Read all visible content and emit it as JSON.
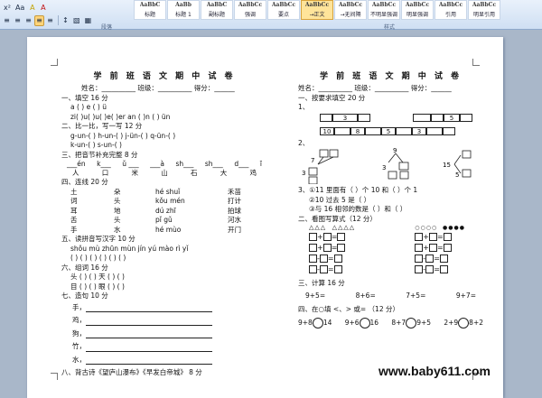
{
  "ribbon": {
    "format_buttons": [
      "x²",
      "Aa",
      "A",
      "A"
    ],
    "paragraph_buttons": [
      "≡",
      "≡",
      "≡",
      "≡",
      "≡"
    ],
    "style_tiles": [
      {
        "sample": "AaBbC",
        "label": "标题"
      },
      {
        "sample": "AaBb",
        "label": "标题 1"
      },
      {
        "sample": "AaBbC",
        "label": "副标题"
      },
      {
        "sample": "AaBbCc",
        "label": "强调"
      },
      {
        "sample": "AaBbCc",
        "label": "要点"
      },
      {
        "sample": "AaBbCc",
        "label": "→正文"
      },
      {
        "sample": "AaBbCc",
        "label": "→无间隔"
      },
      {
        "sample": "AaBbCc",
        "label": "不明显强调"
      },
      {
        "sample": "AaBbCc",
        "label": "明显强调"
      },
      {
        "sample": "AaBbCc",
        "label": "引用"
      },
      {
        "sample": "AaBbCc",
        "label": "明显引用"
      },
      {
        "sample": "AaBbCc",
        "label": "不明显参考"
      }
    ],
    "group_paragraph": "段落",
    "group_styles": "样式"
  },
  "left": {
    "title": "学 前 班 语 文 期 中 试 卷",
    "header_line": "姓名：__________   班级：__________   得分：______",
    "sec1": "一、填空   16 分",
    "sec1_a": "a  (    )  e  (    )  ü",
    "sec1_b": "zi(    )u(    )u(    )e(    )er an  (    )n (    ) ün",
    "sec2": "二、比一比，写一写   12 分",
    "sec2_a": "g-un-(    )     h-un-(    )     j-ün-(    )     q-ün-(    )",
    "sec2_b": "k-un-(    )     s-un-(    )",
    "sec3": "三、把音节补充完整   8 分",
    "pinyin_row": [
      "___én",
      "k___",
      "ǔ ___",
      "___à",
      "sh___",
      "sh___",
      "d___",
      "ī"
    ],
    "hanzi_row": [
      "人",
      "口",
      "米",
      "山",
      "石",
      "大",
      "鸡"
    ],
    "sec4": "四、连线   20 分",
    "match_left": [
      "土",
      "词",
      "耳",
      "舌",
      "手"
    ],
    "match_mid": [
      "朵",
      "头",
      "地",
      "头",
      "水"
    ],
    "match_py": [
      "hé  shuǐ",
      "kǒu  mén",
      "dú  zhī",
      "pǐ  gǔ",
      "hé  mùo"
    ],
    "match_right": [
      "禾苗",
      "打计",
      "拍球",
      "河水",
      "开门"
    ],
    "sec5": "五、读拼音写汉字   10 分",
    "sec5_py": "shǒu  mù    zhūn  mùn    jín    yú  mào    rì    yǐ",
    "sec5_blanks": "(    )  (    )   (    )  (    )   (    )   (    )",
    "sec6": "六、组词   16 分",
    "sec6_a": "头  (      )  (      )        天  (      )  (      )",
    "sec6_b": "目  (      )  (      )        眼  (      )  (      )",
    "sec7": "七、造句   10 分",
    "sentence_labels": [
      "手，",
      "鸡，",
      "狗，",
      "竹，",
      "水，"
    ],
    "sec8": "八、背古诗《望庐山瀑布》《早发白帝城》   8 分"
  },
  "right": {
    "title": "学 前 班 语 文 期 中 试 卷",
    "header_line": "姓名：__________  班级：__________  得分：______",
    "sec1": "一、按要求填空   20 分",
    "sec1_sub": "1、",
    "row_a_left": [
      "",
      "3",
      "",
      ""
    ],
    "row_a_right": [
      "",
      "",
      "5",
      ""
    ],
    "row_b": [
      "10",
      "",
      "8",
      "",
      "5",
      "",
      "3",
      "",
      ""
    ],
    "sec1_sub2": "2、",
    "tree_nums": [
      "7",
      "3",
      "9",
      "3",
      "15",
      "5"
    ],
    "sec1_sub3": "3、①11 里面有（    ）个 10 和（    ）个 1",
    "sec1_sub3b": "②10 过去 5 是（       ）",
    "sec1_sub3c": "③与 16 相邻的数是（       ）和（       ）",
    "sec2": "二、看图写算式（12 分）",
    "sec3": "三、计算   16 分",
    "calc": [
      "9+5=",
      "8+6=",
      "7+5=",
      "9+7="
    ],
    "sec4": "四、在○填 <、> 或= （12 分）",
    "compare": [
      "9+8",
      "14",
      "9+6",
      "16",
      "8+7",
      "9+5",
      "2+9",
      "8+2"
    ]
  },
  "watermark": "www.baby611.com"
}
